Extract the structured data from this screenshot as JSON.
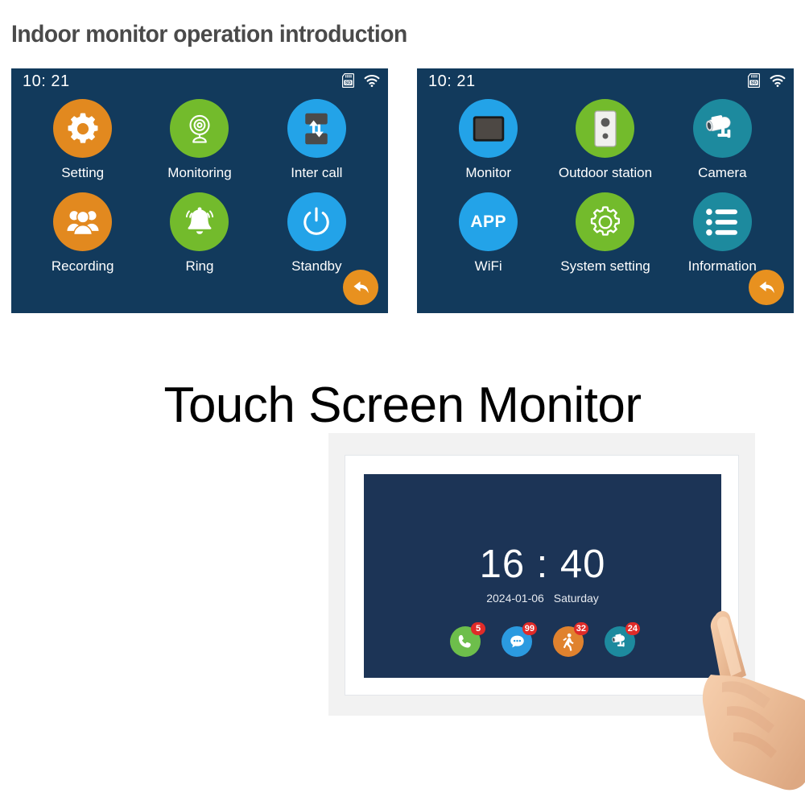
{
  "page": {
    "title": "Indoor monitor operation introduction",
    "hero_title": "Touch Screen Monitor"
  },
  "colors": {
    "screen_bg": "#123a5c",
    "orange": "#e2891f",
    "green": "#73bb2c",
    "blue": "#23a3e8",
    "teal": "#1d8a9e",
    "badge_red": "#e02b28",
    "device_screen_bg": "#1c3456",
    "title_gray": "#4a4a4a"
  },
  "screens": [
    {
      "name": "menu-screen-1",
      "status": {
        "time": "10: 21",
        "icons": [
          "sd-card-icon",
          "wifi-icon"
        ]
      },
      "items": [
        {
          "label": "Setting",
          "icon": "gear-icon",
          "color": "#e2891f"
        },
        {
          "label": "Monitoring",
          "icon": "webcam-icon",
          "color": "#73bb2c"
        },
        {
          "label": "Inter call",
          "icon": "intercom-icon",
          "color": "#23a3e8"
        },
        {
          "label": "Recording",
          "icon": "people-icon",
          "color": "#e2891f"
        },
        {
          "label": "Ring",
          "icon": "bell-icon",
          "color": "#73bb2c"
        },
        {
          "label": "Standby",
          "icon": "power-icon",
          "color": "#23a3e8"
        }
      ],
      "back_button": "back-arrow-icon"
    },
    {
      "name": "menu-screen-2",
      "status": {
        "time": "10: 21",
        "icons": [
          "sd-card-icon",
          "wifi-icon"
        ]
      },
      "items": [
        {
          "label": "Monitor",
          "icon": "monitor-icon",
          "color": "#23a3e8"
        },
        {
          "label": "Outdoor station",
          "icon": "door-station-icon",
          "color": "#73bb2c"
        },
        {
          "label": "Camera",
          "icon": "cctv-camera-icon",
          "color": "#1d8a9e"
        },
        {
          "label": "WiFi",
          "icon": "app-text-icon",
          "color": "#23a3e8",
          "text": "APP"
        },
        {
          "label": "System setting",
          "icon": "gear-outline-icon",
          "color": "#73bb2c"
        },
        {
          "label": "Information",
          "icon": "list-icon",
          "color": "#1d8a9e"
        }
      ],
      "back_button": "back-arrow-icon"
    }
  ],
  "device": {
    "clock": {
      "time": "16 : 40",
      "date": "2024-01-06",
      "weekday": "Saturday"
    },
    "apps": [
      {
        "name": "call-app",
        "icon": "phone-icon",
        "badge": "5",
        "color": "#6dbe4b"
      },
      {
        "name": "message-app",
        "icon": "message-icon",
        "badge": "99",
        "color": "#2b9ae0"
      },
      {
        "name": "motion-app",
        "icon": "walking-icon",
        "badge": "32",
        "color": "#e0822e"
      },
      {
        "name": "camera-app",
        "icon": "cctv-icon",
        "badge": "24",
        "color": "#1d8a9e"
      }
    ],
    "hand": "pointing-hand-icon"
  }
}
